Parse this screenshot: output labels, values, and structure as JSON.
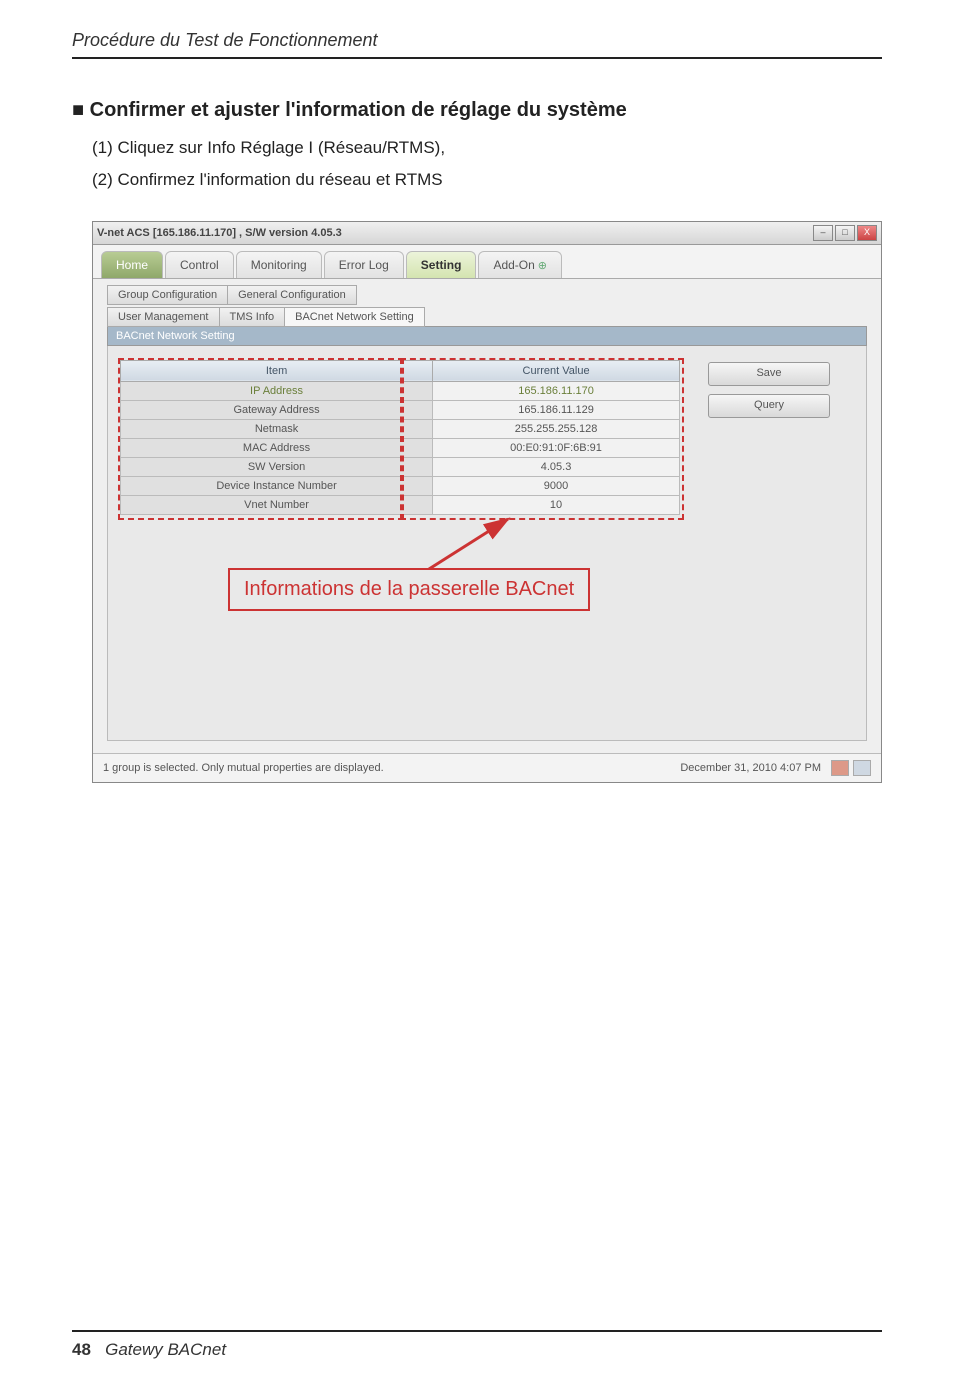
{
  "page_header": "Procédure du Test de Fonctionnement",
  "section_title": "■ Confirmer et ajuster l'information de réglage du système",
  "bullets": [
    "(1) Cliquez sur Info Réglage I (Réseau/RTMS),",
    "(2) Confirmez l'information du réseau et RTMS"
  ],
  "window": {
    "title": "V-net ACS [165.186.11.170] ,   S/W version 4.05.3",
    "controls": {
      "min": "–",
      "max": "□",
      "close": "X"
    }
  },
  "nav": {
    "home": "Home",
    "control": "Control",
    "monitoring": "Monitoring",
    "errorlog": "Error Log",
    "setting": "Setting",
    "addon": "Add-On"
  },
  "subtabs1": [
    "Group Configuration",
    "General Configuration"
  ],
  "subtabs2": [
    "User Management",
    "TMS Info",
    "BACnet Network Setting"
  ],
  "panel_title": "BACnet Network Setting",
  "table": {
    "headers": [
      "Item",
      "Current Value"
    ],
    "rows": [
      {
        "label": "IP Address",
        "value": "165.186.11.170",
        "hl": true
      },
      {
        "label": "Gateway Address",
        "value": "165.186.11.129"
      },
      {
        "label": "Netmask",
        "value": "255.255.255.128"
      },
      {
        "label": "MAC Address",
        "value": "00:E0:91:0F:6B:91"
      },
      {
        "label": "SW Version",
        "value": "4.05.3"
      },
      {
        "label": "Device Instance Number",
        "value": "9000"
      },
      {
        "label": "Vnet Number",
        "value": "10"
      }
    ]
  },
  "buttons": {
    "save": "Save",
    "query": "Query"
  },
  "annotation": "Informations de la passerelle BACnet",
  "statusbar": {
    "left": "1 group is selected. Only mutual properties are displayed.",
    "right": "December 31, 2010  4:07 PM"
  },
  "footer": {
    "page": "48",
    "product": "Gatewy BACnet"
  }
}
